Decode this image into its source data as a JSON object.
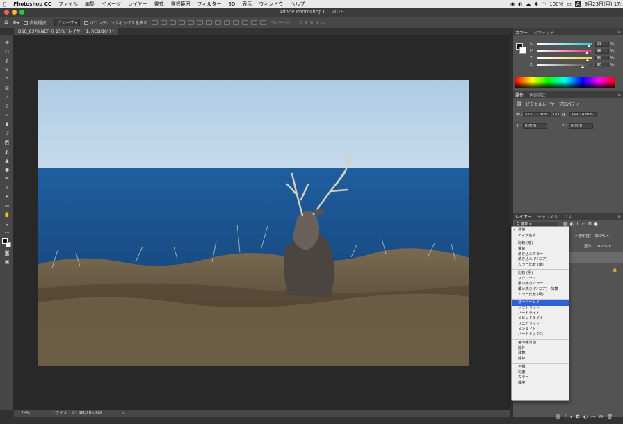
{
  "menubar": {
    "app_name": "Photoshop CC",
    "items": [
      "ファイル",
      "編集",
      "イメージ",
      "レイヤー",
      "書式",
      "選択範囲",
      "フィルター",
      "3D",
      "表示",
      "ウィンドウ",
      "ヘルプ"
    ],
    "battery": "100%",
    "input_indicator": "A",
    "clock": "9月23日(月) 17:"
  },
  "window": {
    "title": "Adobe Photoshop CC 2019"
  },
  "options": {
    "auto_select_label": "自動選択：",
    "auto_select_value": "グループ",
    "bounding_box_label": "バウンディングボックスを表示",
    "mode_3d_label": "3D モード："
  },
  "document": {
    "tab_title": "DSC_8378.NEF @ 25% (レイヤー 1, RGB/16*) *",
    "zoom": "25%",
    "file_info": "ファイル : 93.4M/186.8M"
  },
  "color_panel": {
    "tabs": [
      "カラー",
      "スウォッチ"
    ],
    "channels": [
      {
        "label": "C",
        "value": "91",
        "level": 0.91,
        "color": "#29c3de"
      },
      {
        "label": "M",
        "value": "88",
        "level": 0.88,
        "color": "#d8307c"
      },
      {
        "label": "Y",
        "value": "89",
        "level": 0.89,
        "color": "#e7d631"
      },
      {
        "label": "K",
        "value": "80",
        "level": 0.8,
        "color": "#444444"
      }
    ],
    "percent": "%"
  },
  "properties_panel": {
    "tabs": [
      "属性",
      "色調補正"
    ],
    "subtitle": "ピクセルレイヤープロパティ",
    "w_label": "W :",
    "w_value": "523.77 mm",
    "go_label": "GO",
    "h_label": "H :",
    "h_value": "349.14 mm",
    "x_label": "X :",
    "x_value": "0 mm",
    "y_label": "Y :",
    "y_value": "0 mm"
  },
  "layers_panel": {
    "tabs": [
      "レイヤー",
      "チャンネル",
      "パス"
    ],
    "filter_label": "種類",
    "opacity_label": "不透明度：",
    "opacity_value": "100%",
    "fill_label": "塗り：",
    "fill_value": "100%"
  },
  "blend_menu": {
    "groups": [
      [
        {
          "label": "通常",
          "checked": true
        },
        {
          "label": "ディザ合成"
        }
      ],
      [
        {
          "label": "比較 (暗)"
        },
        {
          "label": "乗算"
        },
        {
          "label": "焼き込みカラー"
        },
        {
          "label": "焼き込み (リニア)"
        },
        {
          "label": "カラー比較 (暗)"
        }
      ],
      [
        {
          "label": "比較 (明)"
        },
        {
          "label": "スクリーン"
        },
        {
          "label": "覆い焼きカラー"
        },
        {
          "label": "覆い焼き (リニア) - 加算"
        },
        {
          "label": "カラー比較 (明)"
        }
      ],
      [
        {
          "label": "オーバーレイ",
          "selected": true
        },
        {
          "label": "ソフトライト"
        },
        {
          "label": "ハードライト"
        },
        {
          "label": "ビビッドライト"
        },
        {
          "label": "リニアライト"
        },
        {
          "label": "ピンライト"
        },
        {
          "label": "ハードミックス"
        }
      ],
      [
        {
          "label": "差の絶対値"
        },
        {
          "label": "除外"
        },
        {
          "label": "減算"
        },
        {
          "label": "除算"
        }
      ],
      [
        {
          "label": "色相"
        },
        {
          "label": "彩度"
        },
        {
          "label": "カラー"
        },
        {
          "label": "輝度"
        }
      ]
    ]
  },
  "toolbar": {
    "tools": [
      "move-tool",
      "marquee-tool",
      "lasso-tool",
      "quick-select-tool",
      "crop-tool",
      "frame-tool",
      "eyedropper-tool",
      "healing-brush-tool",
      "brush-tool",
      "clone-stamp-tool",
      "history-brush-tool",
      "eraser-tool",
      "gradient-tool",
      "blur-tool",
      "dodge-tool",
      "pen-tool",
      "type-tool",
      "path-select-tool",
      "rectangle-tool",
      "hand-tool",
      "zoom-tool",
      "more-tools"
    ]
  },
  "colors": {
    "accent": "#2b63d6",
    "panel": "#535353",
    "toolbar": "#474747"
  }
}
